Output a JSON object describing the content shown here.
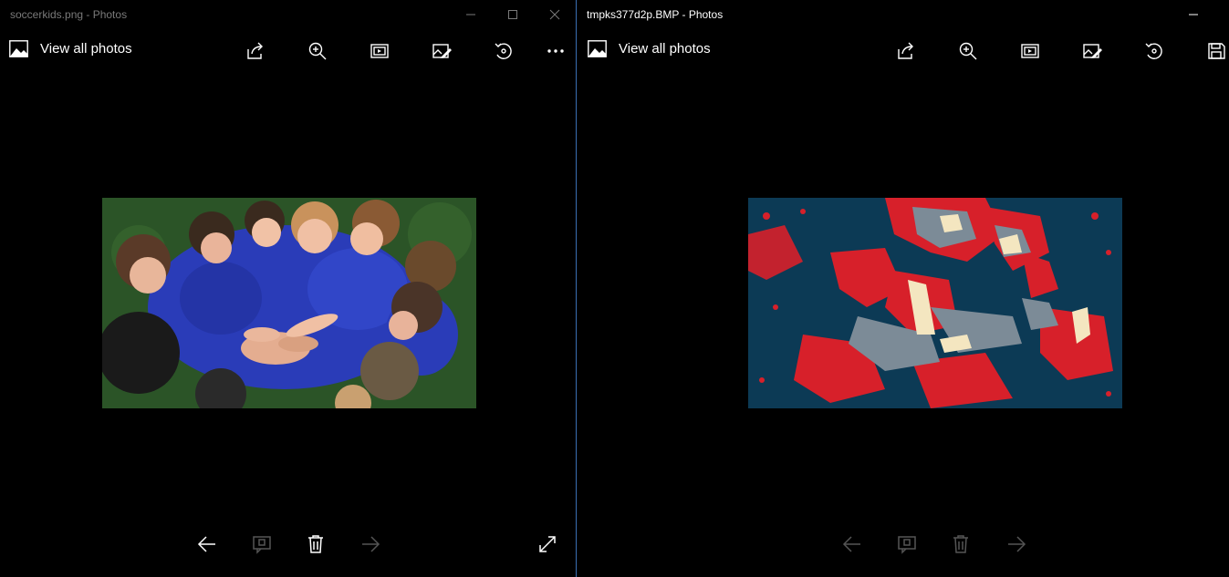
{
  "windows": [
    {
      "title": "soccerkids.png - Photos",
      "view_all_label": "View all photos",
      "toolbar_icons": [
        "share-icon",
        "zoom-in-icon",
        "slideshow-icon",
        "edit-create-icon",
        "rotate-icon",
        "more-icon"
      ],
      "bottom_icons": [
        "previous-arrow-icon",
        "compare-icon",
        "delete-icon",
        "next-arrow-icon",
        "fullscreen-icon"
      ]
    },
    {
      "title": "tmpks377d2p.BMP - Photos",
      "view_all_label": "View all photos",
      "toolbar_icons": [
        "share-icon",
        "zoom-in-icon",
        "slideshow-icon",
        "edit-create-icon",
        "rotate-icon",
        "save-icon"
      ],
      "bottom_icons": [
        "previous-arrow-icon",
        "compare-icon",
        "delete-icon",
        "next-arrow-icon"
      ]
    }
  ],
  "colors": {
    "background": "#000000",
    "poster_navy": "#0c3a55",
    "poster_red": "#d7202a",
    "poster_gray": "#7c8b97",
    "poster_cream": "#f4e6c0",
    "jersey_blue": "#2a3cb8",
    "grass_green": "#2f5a2a",
    "inactive_text": "#7a7a7a",
    "active_border": "#3a6fb3"
  }
}
